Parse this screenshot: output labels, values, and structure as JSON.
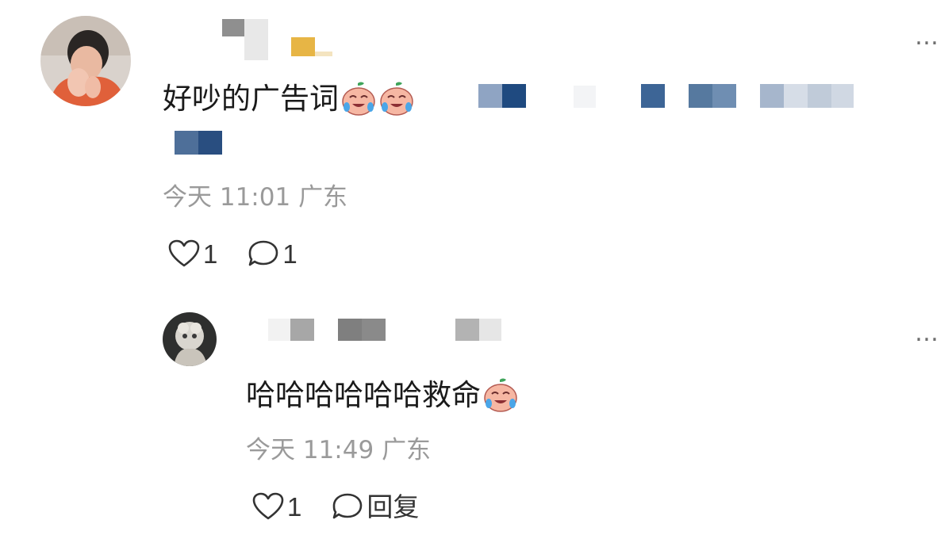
{
  "comments": [
    {
      "text": "好吵的广告词",
      "emoji": [
        "crying-face-emoji",
        "crying-face-emoji"
      ],
      "time": "今天 11:01",
      "location": "广东",
      "likes": "1",
      "replies": "1",
      "more": "…"
    }
  ],
  "reply": {
    "text": "哈哈哈哈哈哈救命",
    "emoji": [
      "crying-face-emoji"
    ],
    "time": "今天 11:49",
    "location": "广东",
    "likes": "1",
    "reply_label": "回复",
    "more": "…"
  },
  "icons": {
    "like": "heart-outline-icon",
    "comment": "speech-bubble-icon",
    "more": "more-dots-icon"
  }
}
